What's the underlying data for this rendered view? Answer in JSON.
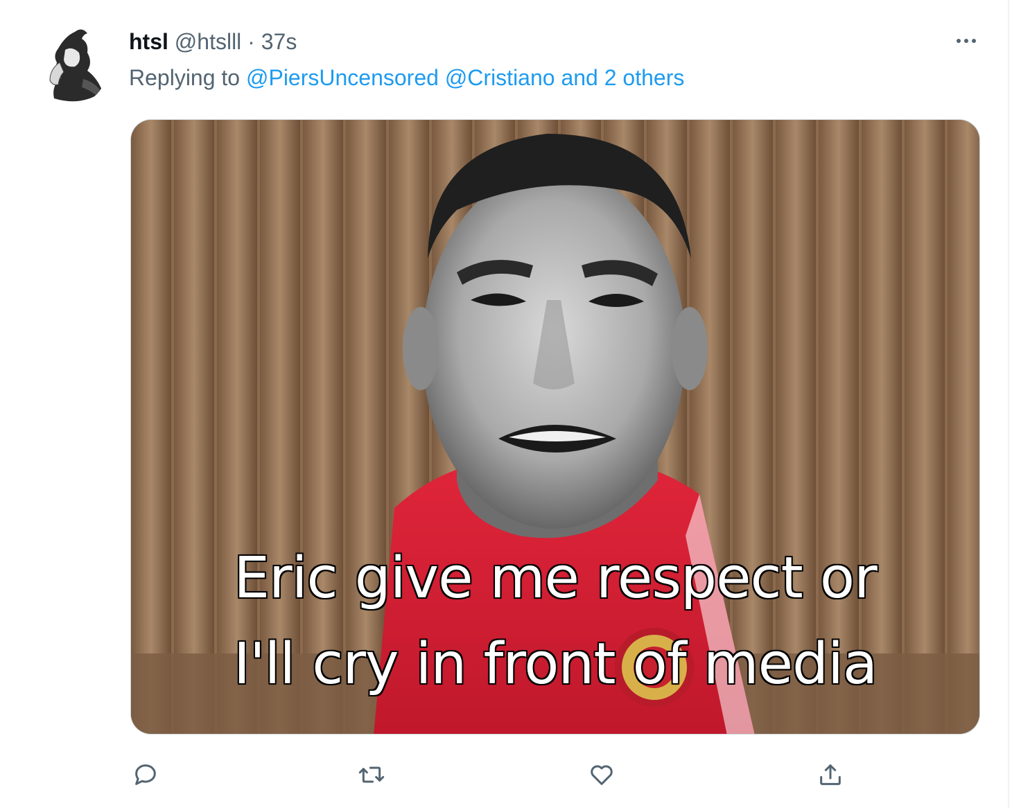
{
  "tweet": {
    "author_name": "htsl",
    "author_handle": "@htslll",
    "separator": "·",
    "timestamp": "37s",
    "reply_prefix": "Replying to",
    "mentions": [
      "@PiersUncensored",
      "@Cristiano",
      "and 2 others"
    ],
    "media": {
      "caption_line_1": "Eric give me respect or",
      "caption_line_2": "I'll cry in front of media"
    }
  },
  "icons": {
    "more": "more-horizontal-icon",
    "reply": "reply-icon",
    "retweet": "retweet-icon",
    "like": "heart-icon",
    "share": "share-icon"
  },
  "colors": {
    "accent": "#1d9bf0",
    "secondary_text": "#536471",
    "primary_text": "#0f1419"
  }
}
